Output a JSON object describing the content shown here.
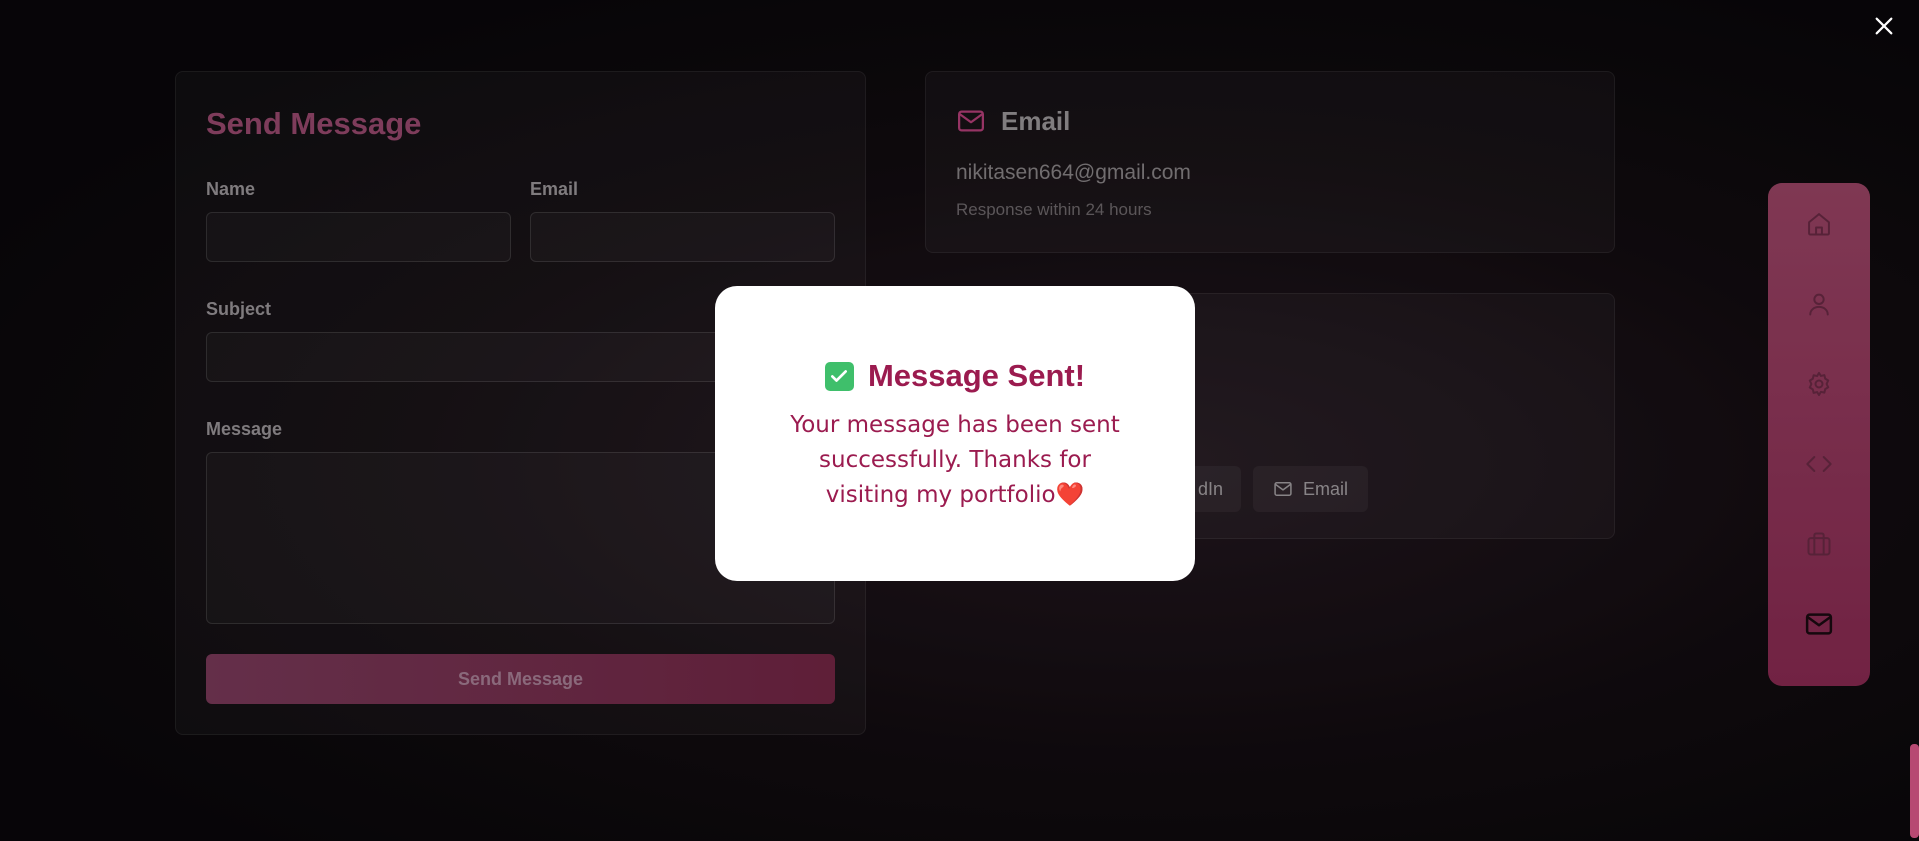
{
  "form": {
    "title": "Send Message",
    "name_label": "Name",
    "email_label": "Email",
    "subject_label": "Subject",
    "message_label": "Message",
    "submit_label": "Send Message"
  },
  "contact_email": {
    "title": "Email",
    "address": "nikitasen664@gmail.com",
    "note": "Response within 24 hours"
  },
  "social": {
    "subtitle_fragment": "s",
    "linkedin_fragment": "dIn",
    "email_button": "Email"
  },
  "dock": {
    "items": [
      "home-icon",
      "user-icon",
      "gear-icon",
      "code-icon",
      "briefcase-icon",
      "mail-icon"
    ],
    "active": "mail-icon"
  },
  "modal": {
    "title": "Message Sent!",
    "body": "Your message has been sent successfully. Thanks for visiting my portfolio",
    "heart": "❤️"
  },
  "colors": {
    "accent": "#9b1b4f",
    "dock": "#8f2f57",
    "success": "#3fbf6b"
  }
}
